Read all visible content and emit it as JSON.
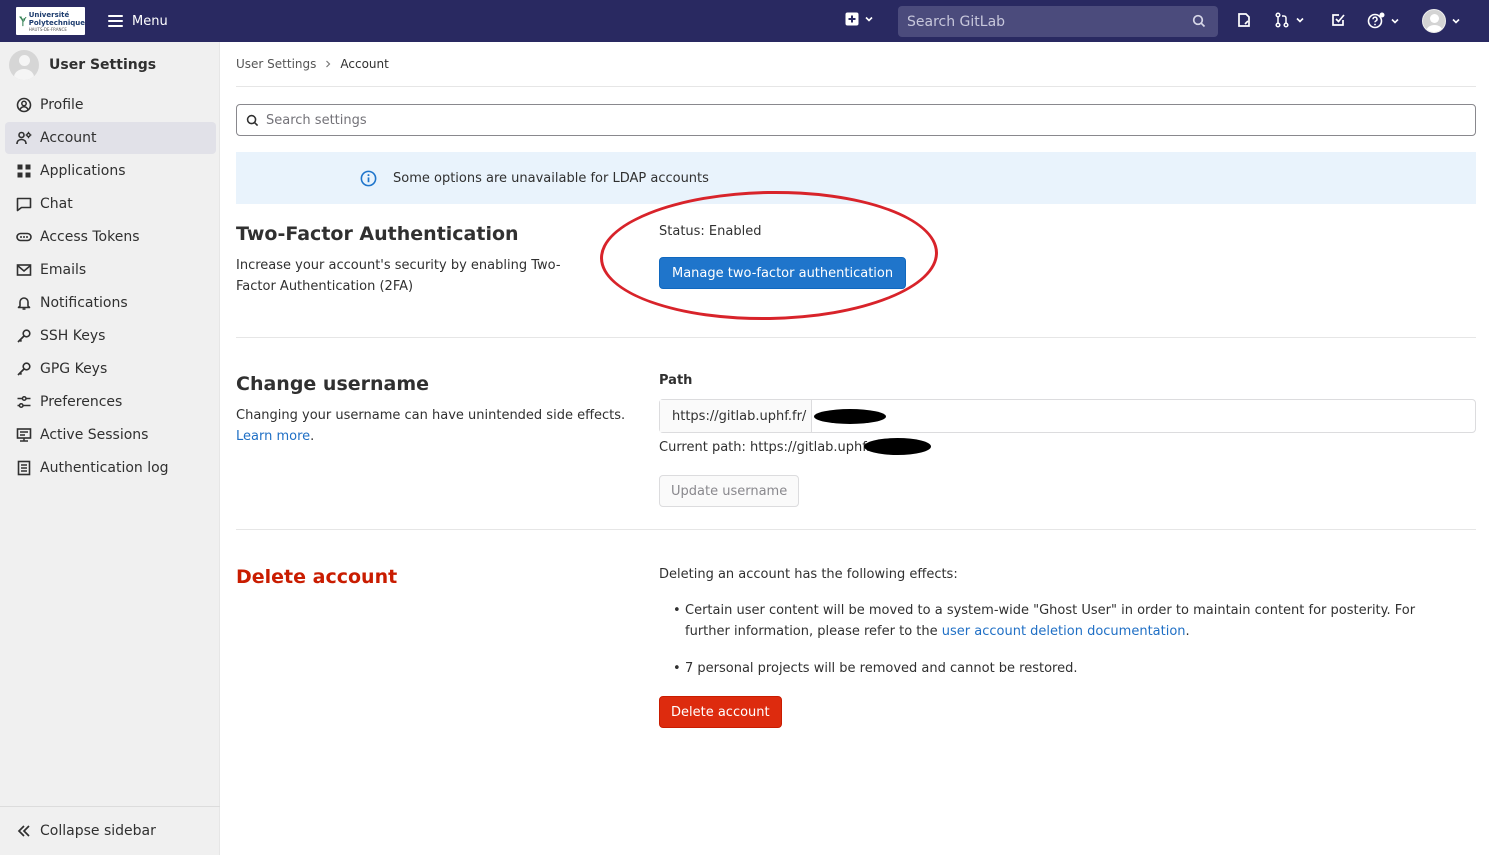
{
  "topbar": {
    "logo_line1": "Université",
    "logo_line2": "Polytechnique",
    "logo_line3": "HAUTS-DE-FRANCE",
    "menu_label": "Menu",
    "search_placeholder": "Search GitLab"
  },
  "sidebar": {
    "title": "User Settings",
    "items": [
      {
        "label": "Profile",
        "icon": "profile-icon"
      },
      {
        "label": "Account",
        "icon": "account-icon",
        "active": true
      },
      {
        "label": "Applications",
        "icon": "applications-icon"
      },
      {
        "label": "Chat",
        "icon": "chat-icon"
      },
      {
        "label": "Access Tokens",
        "icon": "token-icon"
      },
      {
        "label": "Emails",
        "icon": "mail-icon"
      },
      {
        "label": "Notifications",
        "icon": "bell-icon"
      },
      {
        "label": "SSH Keys",
        "icon": "key-icon"
      },
      {
        "label": "GPG Keys",
        "icon": "key-icon"
      },
      {
        "label": "Preferences",
        "icon": "preferences-icon"
      },
      {
        "label": "Active Sessions",
        "icon": "monitor-icon"
      },
      {
        "label": "Authentication log",
        "icon": "log-icon"
      }
    ],
    "collapse_label": "Collapse sidebar"
  },
  "breadcrumb": {
    "parent": "User Settings",
    "current": "Account"
  },
  "search_settings": {
    "placeholder": "Search settings"
  },
  "alert": {
    "text": "Some options are unavailable for LDAP accounts"
  },
  "two_factor": {
    "title": "Two-Factor Authentication",
    "description": "Increase your account's security by enabling Two-Factor Authentication (2FA)",
    "status": "Status: Enabled",
    "button": "Manage two-factor authentication"
  },
  "change_username": {
    "title": "Change username",
    "description": "Changing your username can have unintended side effects.",
    "learn_more": "Learn more",
    "period": ".",
    "path_label": "Path",
    "path_prefix": "https://gitlab.uphf.fr/",
    "current_path": "Current path: https://gitlab.uphf.fr",
    "button": "Update username"
  },
  "delete_account": {
    "title": "Delete account",
    "intro": "Deleting an account has the following effects:",
    "bullet1_text": "Certain user content will be moved to a system-wide \"Ghost User\" in order to maintain content for posterity. For further information, please refer to the ",
    "bullet1_link": "user account deletion documentation",
    "bullet1_end": ".",
    "bullet2": "7 personal projects will be removed and cannot be restored.",
    "button": "Delete account"
  },
  "colors": {
    "topbar": "#292961",
    "primary": "#1f75cb",
    "danger": "#dd2b0e",
    "annotation": "#d8232a"
  }
}
